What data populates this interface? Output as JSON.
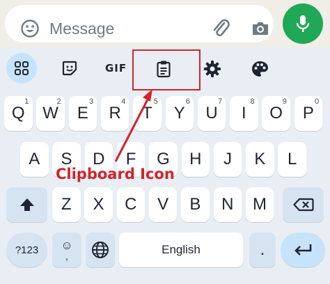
{
  "message_bar": {
    "placeholder": "Message"
  },
  "toolbar": {
    "gif_label": "GIF"
  },
  "keyboard": {
    "row1": [
      {
        "label": "Q",
        "hint": "1"
      },
      {
        "label": "W",
        "hint": "2"
      },
      {
        "label": "E",
        "hint": "3"
      },
      {
        "label": "R",
        "hint": "4"
      },
      {
        "label": "T",
        "hint": "5"
      },
      {
        "label": "Y",
        "hint": "6"
      },
      {
        "label": "U",
        "hint": "7"
      },
      {
        "label": "I",
        "hint": "8"
      },
      {
        "label": "O",
        "hint": "9"
      },
      {
        "label": "P",
        "hint": "0"
      }
    ],
    "row2": [
      "A",
      "S",
      "D",
      "F",
      "G",
      "H",
      "J",
      "K",
      "L"
    ],
    "row3": [
      "Z",
      "X",
      "C",
      "V",
      "B",
      "N",
      "M"
    ],
    "symbols_label": "?123",
    "emoji_sub": ",",
    "space_label": "English",
    "period_label": "."
  },
  "annotation": {
    "label": "Clipboard Icon",
    "color": "#d2232a"
  },
  "colors": {
    "mic_button": "#1fa855",
    "keyboard_bg": "#e9eef5",
    "function_key": "#d6e4f2",
    "accent_key": "#c7e3fb"
  }
}
